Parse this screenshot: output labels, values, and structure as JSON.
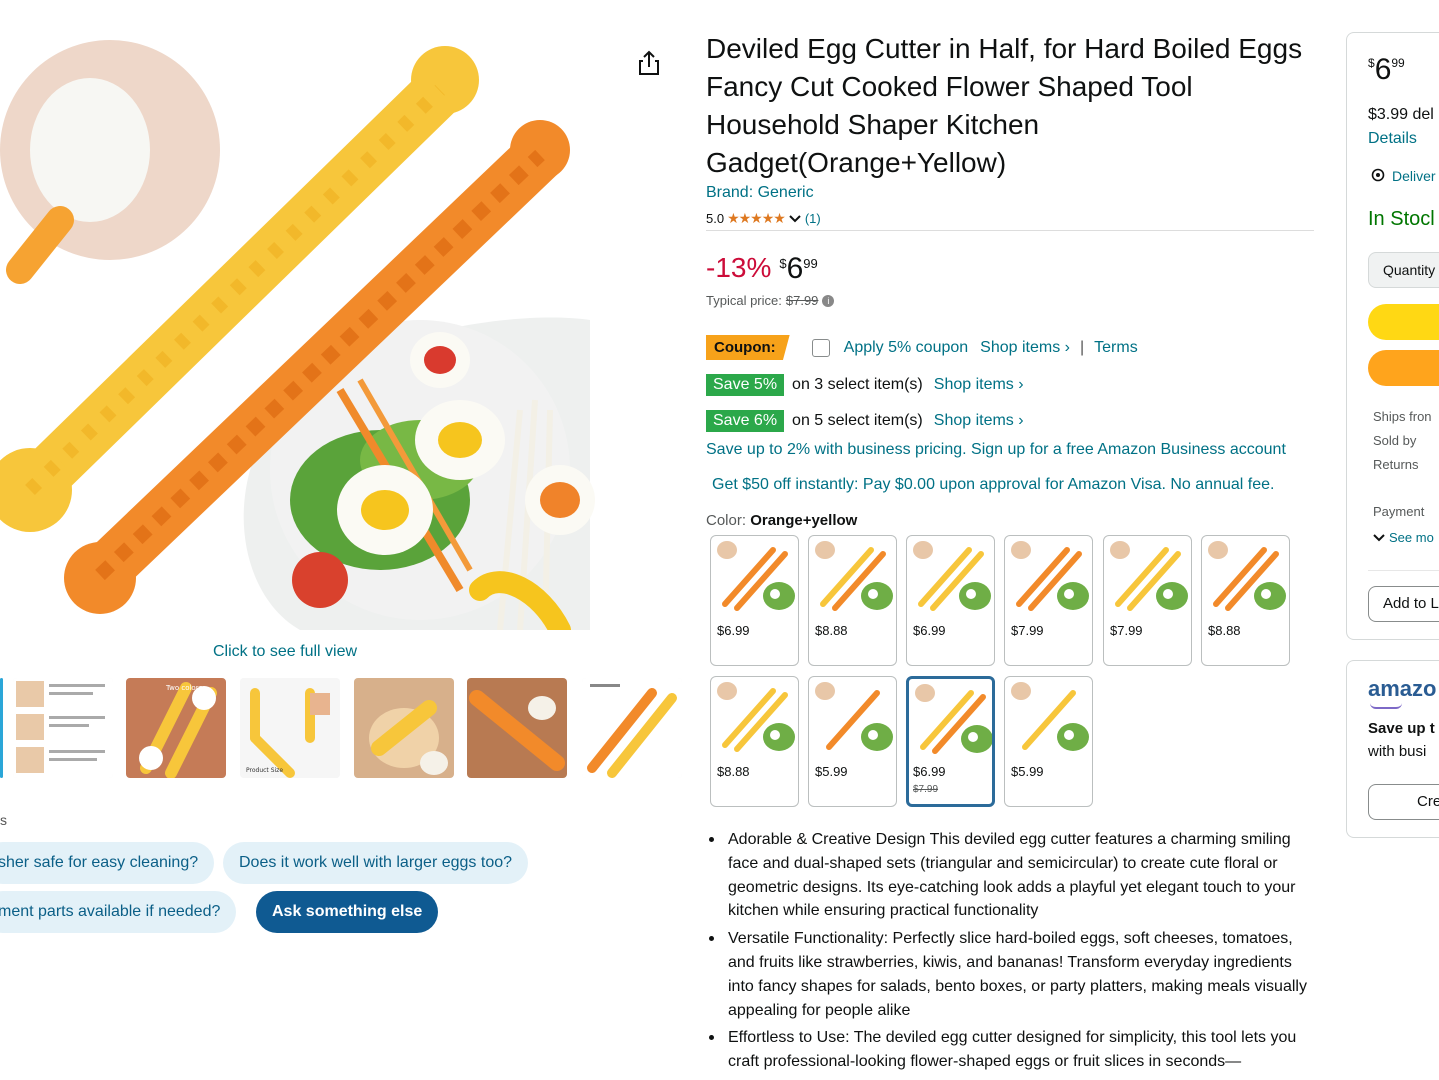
{
  "product": {
    "title": "Deviled Egg Cutter in Half, for Hard Boiled Eggs Fancy Cut Cooked Flower Shaped Tool Household Shaper Kitchen Gadget(Orange+Yellow)",
    "brand": "Brand: Generic",
    "rating_value": "5.0",
    "rating_stars": "★★★★★",
    "rating_count": "(1)"
  },
  "media": {
    "full_view_label": "Click to see full view",
    "thumb_small_text_1": "Two colors",
    "thumb_small_text_2": "Product Size"
  },
  "questions": {
    "chip1": "sher safe for easy cleaning?",
    "chip2": "Does it work well with larger eggs too?",
    "chip3": "ment parts available if needed?",
    "ask": "Ask something else",
    "edge_mark": "s"
  },
  "pricing": {
    "discount": "-13%",
    "currency": "$",
    "whole": "6",
    "fraction": "99",
    "typical_label": "Typical price:",
    "typical_value": "$7.99",
    "info_icon": "i"
  },
  "coupon": {
    "badge": "Coupon:",
    "apply": "Apply 5% coupon",
    "shop": "Shop items ›",
    "sep": "|",
    "terms": "Terms"
  },
  "savings": [
    {
      "badge": "Save 5%",
      "text": "on 3 select item(s)",
      "link": "Shop items ›"
    },
    {
      "badge": "Save 6%",
      "text": "on 5 select item(s)",
      "link": "Shop items ›"
    }
  ],
  "business_pricing": "Save up to 2% with business pricing. Sign up for a free Amazon Business account",
  "visa_offer": "Get $50 off instantly: Pay $0.00 upon approval for Amazon Visa. No annual fee.",
  "color": {
    "label": "Color:",
    "selected": "Orange+yellow",
    "options": [
      {
        "price": "$6.99",
        "variant": "orange"
      },
      {
        "price": "$8.88",
        "variant": "mixed"
      },
      {
        "price": "$6.99",
        "variant": "yellow"
      },
      {
        "price": "$7.99",
        "variant": "orange"
      },
      {
        "price": "$7.99",
        "variant": "yellow"
      },
      {
        "price": "$8.88",
        "variant": "orange"
      },
      {
        "price": "$8.88",
        "variant": "yellow"
      },
      {
        "price": "$5.99",
        "variant": "orange"
      },
      {
        "price": "$6.99",
        "old_price": "$7.99",
        "variant": "mixed",
        "selected": true
      },
      {
        "price": "$5.99",
        "variant": "yellow"
      }
    ]
  },
  "bullets": [
    "Adorable & Creative Design This deviled egg cutter features a charming smiling face and dual-shaped sets (triangular and semicircular) to create cute floral or geometric designs. Its eye-catching look adds a playful yet elegant touch to your kitchen while ensuring practical functionality",
    "Versatile Functionality: Perfectly slice hard-boiled eggs, soft cheeses, tomatoes, and fruits like strawberries, kiwis, and bananas! Transform everyday ingredients into fancy shapes for salads, bento boxes, or party platters, making meals visually appealing for people alike",
    "Effortless to Use: The deviled egg cutter designed for simplicity, this tool lets you craft professional-looking flower-shaped eggs or fruit slices in seconds—"
  ],
  "buybox": {
    "currency": "$",
    "whole": "6",
    "fraction": "99",
    "delivery": "$3.99 del",
    "details": "Details",
    "deliver_to": "Deliver",
    "stock": "In Stocl",
    "quantity": "Quantity",
    "ships_from": "Ships fron",
    "sold_by": "Sold by",
    "returns": "Returns",
    "payment": "Payment",
    "see_more": "See mo",
    "add_list": "Add to L"
  },
  "business_box": {
    "logo": "amazo",
    "save": "Save up t",
    "with": "with busi",
    "button": "Cre"
  },
  "colors": {
    "link": "#007185",
    "price_red": "#cc0c39",
    "save_green": "#2ba84a",
    "coupon_orange": "#f7a21a",
    "cart_yellow": "#ffd814",
    "buy_orange": "#ffa41c",
    "stock_green": "#007600"
  }
}
